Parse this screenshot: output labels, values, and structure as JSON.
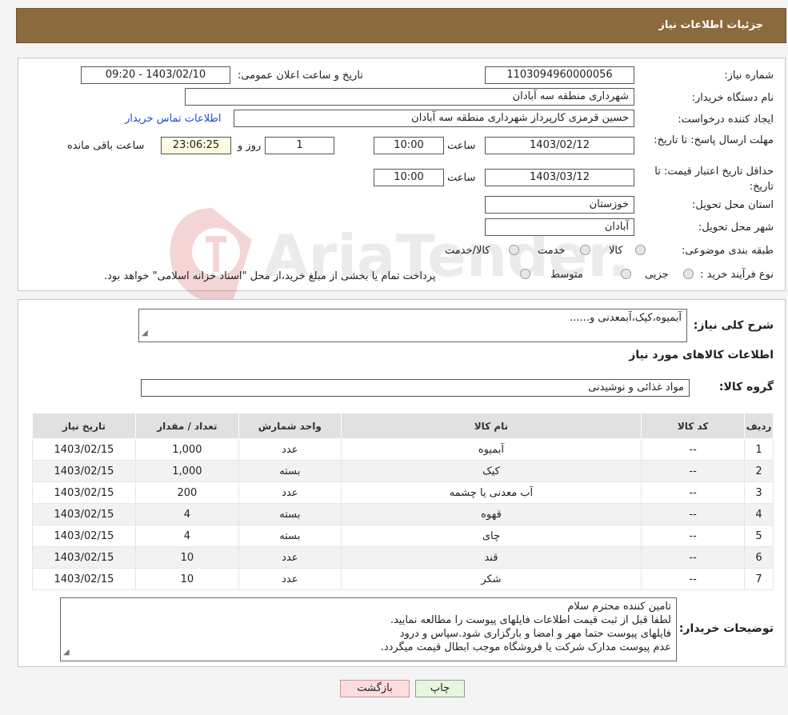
{
  "header": {
    "title": "جزئیات اطلاعات نیاز"
  },
  "form": {
    "need_number_label": "شماره نیاز:",
    "need_number": "1103094960000056",
    "announce_label": "تاریخ و ساعت اعلان عمومی:",
    "announce_value": "1403/02/10 - 09:20",
    "buyer_org_label": "نام دستگاه خریدار:",
    "buyer_org": "شهرداری منطقه سه آبادان",
    "creator_label": "ایجاد کننده درخواست:",
    "creator": "حسین قرمزی کارپرداز شهرداری منطقه سه آبادان",
    "contact_link": "اطلاعات تماس خریدار",
    "reply_deadline_label": "مهلت ارسال پاسخ: تا تاریخ:",
    "reply_date": "1403/02/12",
    "time_label": "ساعت",
    "reply_time": "10:00",
    "days_value": "1",
    "days_label": "روز و",
    "remaining_value": "23:06:25",
    "remaining_label": "ساعت باقی مانده",
    "price_validity_label": "حداقل تاریخ اعتبار قیمت: تا تاریخ:",
    "validity_date": "1403/03/12",
    "validity_time": "10:00",
    "province_label": "استان محل تحویل:",
    "province": "خوزستان",
    "city_label": "شهر محل تحویل:",
    "city": "آبادان",
    "category_label": "طبقه بندی موضوعی:",
    "category_options": [
      "کالا",
      "خدمت",
      "کالا/خدمت"
    ],
    "process_label": "نوع فرآیند خرید :",
    "process_options": [
      "جزیی",
      "متوسط"
    ],
    "process_note": "پرداخت تمام یا بخشی از مبلغ خرید،از محل \"اسناد خزانه اسلامی\" خواهد بود."
  },
  "need": {
    "summary_label": "شرح کلی نیاز:",
    "summary": "آبمیوه،کیک،آبمعدنی و......",
    "items_heading": "اطلاعات کالاهای مورد نیاز",
    "group_label": "گروه کالا:",
    "group": "مواد غذائی و نوشیدنی"
  },
  "table": {
    "headers": [
      "ردیف",
      "کد کالا",
      "نام کالا",
      "واحد شمارش",
      "تعداد / مقدار",
      "تاریخ نیاز"
    ],
    "rows": [
      [
        "1",
        "--",
        "آبمیوه",
        "عدد",
        "1,000",
        "1403/02/15"
      ],
      [
        "2",
        "--",
        "کیک",
        "بسته",
        "1,000",
        "1403/02/15"
      ],
      [
        "3",
        "--",
        "آب معدنی یا چشمه",
        "عدد",
        "200",
        "1403/02/15"
      ],
      [
        "4",
        "--",
        "قهوه",
        "بسته",
        "4",
        "1403/02/15"
      ],
      [
        "5",
        "--",
        "چای",
        "بسته",
        "4",
        "1403/02/15"
      ],
      [
        "6",
        "--",
        "قند",
        "عدد",
        "10",
        "1403/02/15"
      ],
      [
        "7",
        "--",
        "شکر",
        "عدد",
        "10",
        "1403/02/15"
      ]
    ]
  },
  "buyer_notes": {
    "label": "توضیحات خریدار:",
    "lines": [
      "تامین کننده محترم سلام",
      "لطفا قبل از ثبت قیمت اطلاعات فایلهای پیوست را مطالعه نمایید.",
      "فایلهای پیوست حتما مهر و امضا و بارگزاری شود.سپاس و درود",
      "عدم پیوست مدارک شرکت یا فروشگاه موجب ابطال قیمت میگردد."
    ]
  },
  "buttons": {
    "print": "چاپ",
    "back": "بازگشت"
  },
  "watermark": {
    "text": "AriaTender.neT"
  },
  "colors": {
    "header_bg": "#8b6b3e",
    "link": "#1a4fd1",
    "back_button": "#fcdcdc",
    "print_button": "#e4f7dc"
  }
}
